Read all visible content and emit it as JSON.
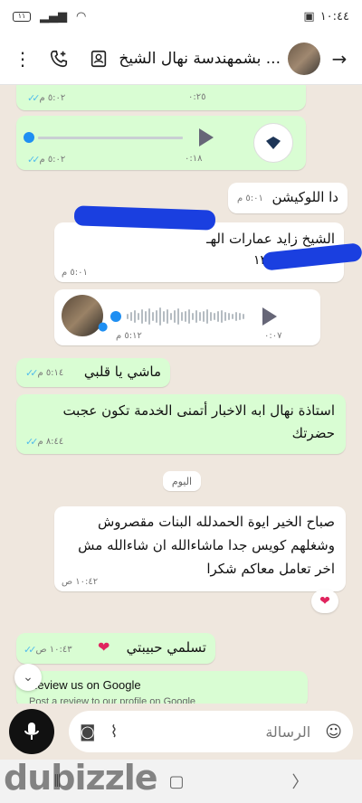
{
  "status": {
    "time": "١٠:٤٤",
    "battery": "١١"
  },
  "header": {
    "title": "بشمهندسة نهال الشيخ ..."
  },
  "messages": {
    "voice1_time": "٥:٠٢ م",
    "voice1_duration": "٠:٢٥",
    "voice2_time": "٥:٠٢ م",
    "voice2_duration": "٠:١٨",
    "m1_text": "دا اللوكيشن",
    "m1_time": "٥:٠١ م",
    "m2_text": "الشيخ زايد عمارات الهـ",
    "m2_line2": "١٢",
    "m2_time": "٥:٠١ م",
    "voice3_time": "٥:١٢ م",
    "voice3_duration": "٠:٠٧",
    "m3_text": "ماشي يا قلبي",
    "m3_time": "٥:١٤ م",
    "m4_text": "استاذة نهال ابه الاخبار أتمنى الخدمة تكون عجبت حضرتك",
    "m4_time": "٨:٤٤ م",
    "date_label": "اليوم",
    "m5_text": "صباح الخير ايوة الحمدلله البنات مقصروش وشغلهم كويس جدا ماشاءالله ان شاءالله مش اخر تعامل معاكم شكرا",
    "m5_time": "١٠:٤٢ ص",
    "m6_text": "تسلمي حبيبتي",
    "m6_time": "١٠:٤٣ ص",
    "google_title": "Review us on Google",
    "google_sub": "Post a review to our profile on Google"
  },
  "input": {
    "placeholder": "الرسالة"
  },
  "watermark": "dubizzle",
  "colors": {
    "outgoing": "#d9fdd3",
    "incoming": "#ffffff",
    "ticks": "#53bdeb",
    "redaction": "#1a3fe0"
  }
}
